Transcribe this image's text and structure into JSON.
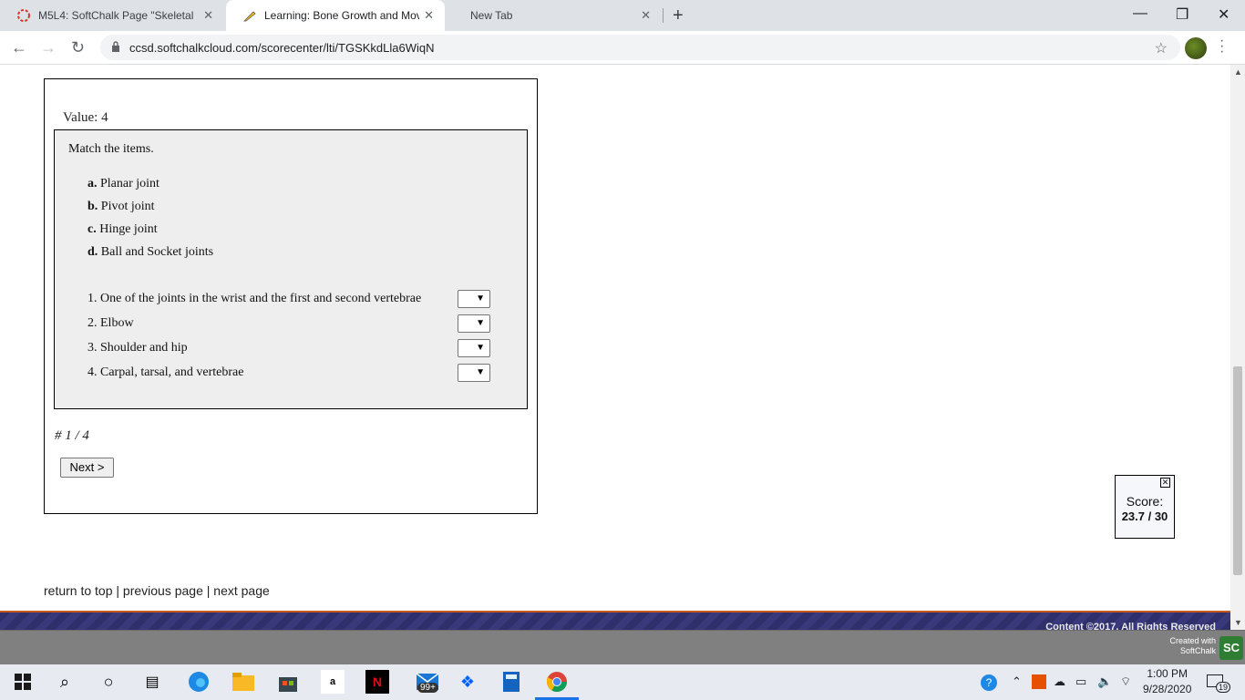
{
  "browser": {
    "tabs": [
      {
        "title": "M5L4: SoftChalk Page \"Skeletal S",
        "icon": "softchalk-icon"
      },
      {
        "title": "Learning: Bone Growth and Move",
        "icon": "pencil-icon"
      },
      {
        "title": "New Tab",
        "icon": ""
      }
    ],
    "url": "ccsd.softchalkcloud.com/scorecenter/lti/TGSKkdLla6WiqN"
  },
  "quiz": {
    "value_label": "Value: 4",
    "instruction": "Match the items.",
    "choices": [
      {
        "letter": "a.",
        "text": "Planar joint"
      },
      {
        "letter": "b.",
        "text": "Pivot joint"
      },
      {
        "letter": "c.",
        "text": "Hinge joint"
      },
      {
        "letter": "d.",
        "text": "Ball and Socket joints"
      }
    ],
    "items": [
      {
        "label": "1. One of the joints in the wrist and the first and second vertebrae",
        "selected": ""
      },
      {
        "label": "2. Elbow",
        "selected": ""
      },
      {
        "label": "3. Shoulder and hip",
        "selected": ""
      },
      {
        "label": "4. Carpal, tarsal, and vertebrae",
        "selected": ""
      }
    ],
    "counter": "# 1 / 4",
    "next_label": "Next >"
  },
  "score": {
    "label": "Score:",
    "value": "23.7 / 30"
  },
  "footer": {
    "return_top": "return to top",
    "separator": "|",
    "previous_page": "previous page",
    "next_page": "next page",
    "copyright": "Content ©2017. All Rights Reserved",
    "created_line1": "Created with",
    "created_line2": "SoftChalk",
    "sc_logo": "SC"
  },
  "taskbar": {
    "mail_badge": "99+",
    "time": "1:00 PM",
    "date": "9/28/2020",
    "notification_count": "19"
  }
}
